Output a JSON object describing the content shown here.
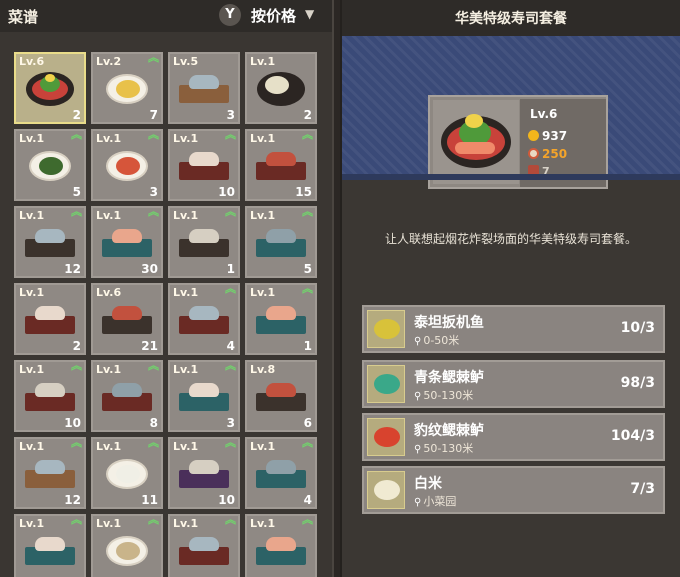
{
  "left": {
    "title": "菜谱",
    "sort_key": "Y",
    "sort_label": "按价格",
    "sort_arrow": "▼",
    "recipes": [
      {
        "lv": "Lv.6",
        "count": "2",
        "upgrade": false,
        "selected": true,
        "kind": "platter"
      },
      {
        "lv": "Lv.2",
        "count": "7",
        "upgrade": true,
        "kind": "yellow"
      },
      {
        "lv": "Lv.5",
        "count": "3",
        "upgrade": false,
        "kind": "board-wood"
      },
      {
        "lv": "Lv.1",
        "count": "2",
        "upgrade": false,
        "kind": "flower"
      },
      {
        "lv": "Lv.1",
        "count": "5",
        "upgrade": true,
        "kind": "green"
      },
      {
        "lv": "Lv.1",
        "count": "3",
        "upgrade": true,
        "kind": "salad"
      },
      {
        "lv": "Lv.1",
        "count": "10",
        "upgrade": true,
        "kind": "board-red"
      },
      {
        "lv": "Lv.1",
        "count": "15",
        "upgrade": true,
        "kind": "board-red"
      },
      {
        "lv": "Lv.1",
        "count": "12",
        "upgrade": true,
        "kind": "board-dark"
      },
      {
        "lv": "Lv.1",
        "count": "30",
        "upgrade": true,
        "kind": "board-teal"
      },
      {
        "lv": "Lv.1",
        "count": "1",
        "upgrade": true,
        "kind": "board-dark"
      },
      {
        "lv": "Lv.1",
        "count": "5",
        "upgrade": true,
        "kind": "board-teal"
      },
      {
        "lv": "Lv.1",
        "count": "2",
        "upgrade": false,
        "kind": "board-red"
      },
      {
        "lv": "Lv.6",
        "count": "21",
        "upgrade": false,
        "kind": "board-dark"
      },
      {
        "lv": "Lv.1",
        "count": "4",
        "upgrade": true,
        "kind": "board-red"
      },
      {
        "lv": "Lv.1",
        "count": "1",
        "upgrade": true,
        "kind": "board-teal"
      },
      {
        "lv": "Lv.1",
        "count": "10",
        "upgrade": true,
        "kind": "board-red"
      },
      {
        "lv": "Lv.1",
        "count": "8",
        "upgrade": true,
        "kind": "board-red"
      },
      {
        "lv": "Lv.1",
        "count": "3",
        "upgrade": true,
        "kind": "board-teal"
      },
      {
        "lv": "Lv.8",
        "count": "6",
        "upgrade": false,
        "kind": "board-dark"
      },
      {
        "lv": "Lv.1",
        "count": "12",
        "upgrade": true,
        "kind": "board-wood"
      },
      {
        "lv": "Lv.1",
        "count": "11",
        "upgrade": true,
        "kind": "onigiri"
      },
      {
        "lv": "Lv.1",
        "count": "10",
        "upgrade": true,
        "kind": "board-purple"
      },
      {
        "lv": "Lv.1",
        "count": "4",
        "upgrade": true,
        "kind": "board-teal"
      },
      {
        "lv": "Lv.1",
        "count": "",
        "upgrade": true,
        "kind": "board-teal"
      },
      {
        "lv": "Lv.1",
        "count": "",
        "upgrade": true,
        "kind": "bowl"
      },
      {
        "lv": "Lv.1",
        "count": "",
        "upgrade": true,
        "kind": "board-red"
      },
      {
        "lv": "Lv.1",
        "count": "",
        "upgrade": true,
        "kind": "board-teal"
      }
    ]
  },
  "right": {
    "title": "华美特级寿司套餐",
    "item": {
      "lv": "Lv.6",
      "price": "937",
      "tip": "250",
      "stock": "7"
    },
    "description": "让人联想起烟花炸裂场面的华美特级寿司套餐。",
    "ingredients": [
      {
        "name": "泰坦扳机鱼",
        "location": "0-50米",
        "count": "10/3",
        "icon": "titan-triggerfish-icon",
        "color": "#d8c23a"
      },
      {
        "name": "青条鳃棘鲈",
        "location": "50-130米",
        "count": "98/3",
        "icon": "blue-striped-grouper-icon",
        "color": "#3aa889"
      },
      {
        "name": "豹纹鳃棘鲈",
        "location": "50-130米",
        "count": "104/3",
        "icon": "leopard-coral-grouper-icon",
        "color": "#d8432e"
      },
      {
        "name": "白米",
        "location": "小菜园",
        "count": "7/3",
        "icon": "rice-icon",
        "color": "#f0ead2"
      }
    ]
  },
  "colors": {
    "accent_green": "#6fd86a",
    "coin_gold": "#f2b51c",
    "tip_orange": "#f4a42a",
    "banner_blue": "#3a4a78"
  }
}
